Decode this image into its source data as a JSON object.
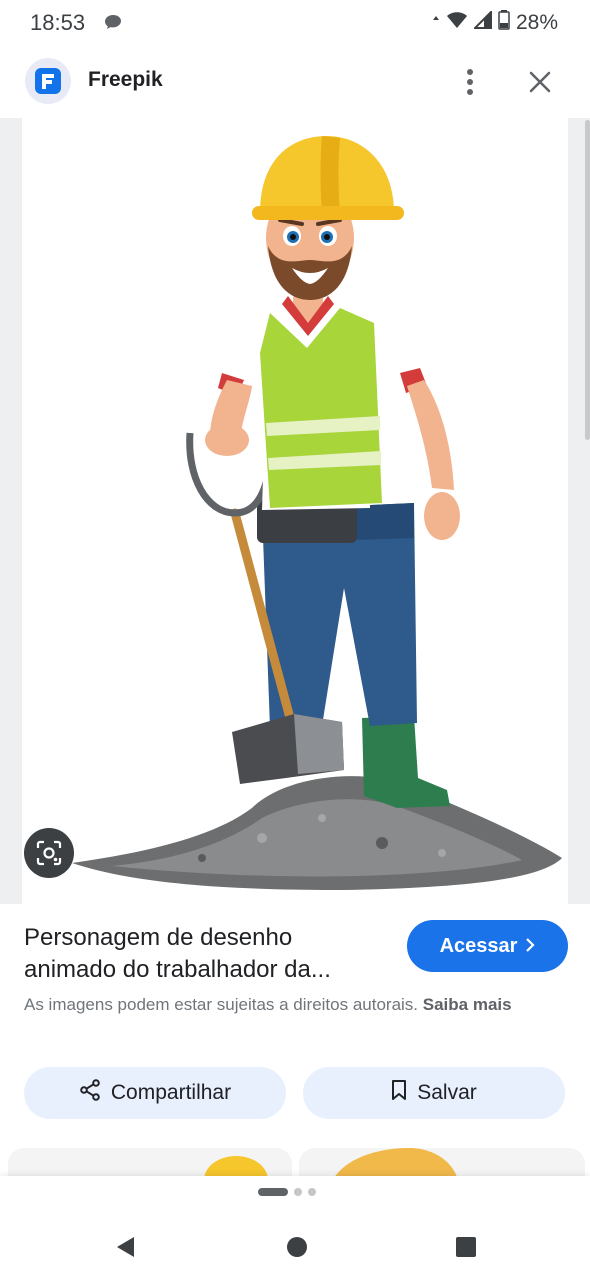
{
  "status_bar": {
    "time": "18:53",
    "battery": "28%",
    "icons": [
      "message-icon",
      "data-arrows-icon",
      "wifi-icon",
      "signal-icon",
      "battery-icon"
    ]
  },
  "header": {
    "site_name": "Freepik",
    "logo_icon": "freepik-logo-icon",
    "logo_color": "#1273eb",
    "menu_icon": "more-vert-icon",
    "close_icon": "close-icon"
  },
  "image": {
    "subject": "cartoon construction worker with hard hat, safety vest and shovel on gravel pile",
    "lens_icon": "lens-icon"
  },
  "info": {
    "title": "Personagem de desenho animado do trabalhador da...",
    "visit_label": "Acessar",
    "visit_icon": "chevron-right-icon",
    "copyright_text": "As imagens podem estar sujeitas a direitos autorais.",
    "learn_more": "Saiba mais"
  },
  "actions": {
    "share_label": "Compartilhar",
    "share_icon": "share-icon",
    "save_label": "Salvar",
    "save_icon": "bookmark-icon"
  },
  "colors": {
    "accent": "#1a73e8",
    "chip_bg": "#e8f0fe",
    "text_secondary": "#70757a"
  },
  "nav": {
    "icons": [
      "back-icon",
      "home-icon",
      "recents-icon"
    ]
  }
}
